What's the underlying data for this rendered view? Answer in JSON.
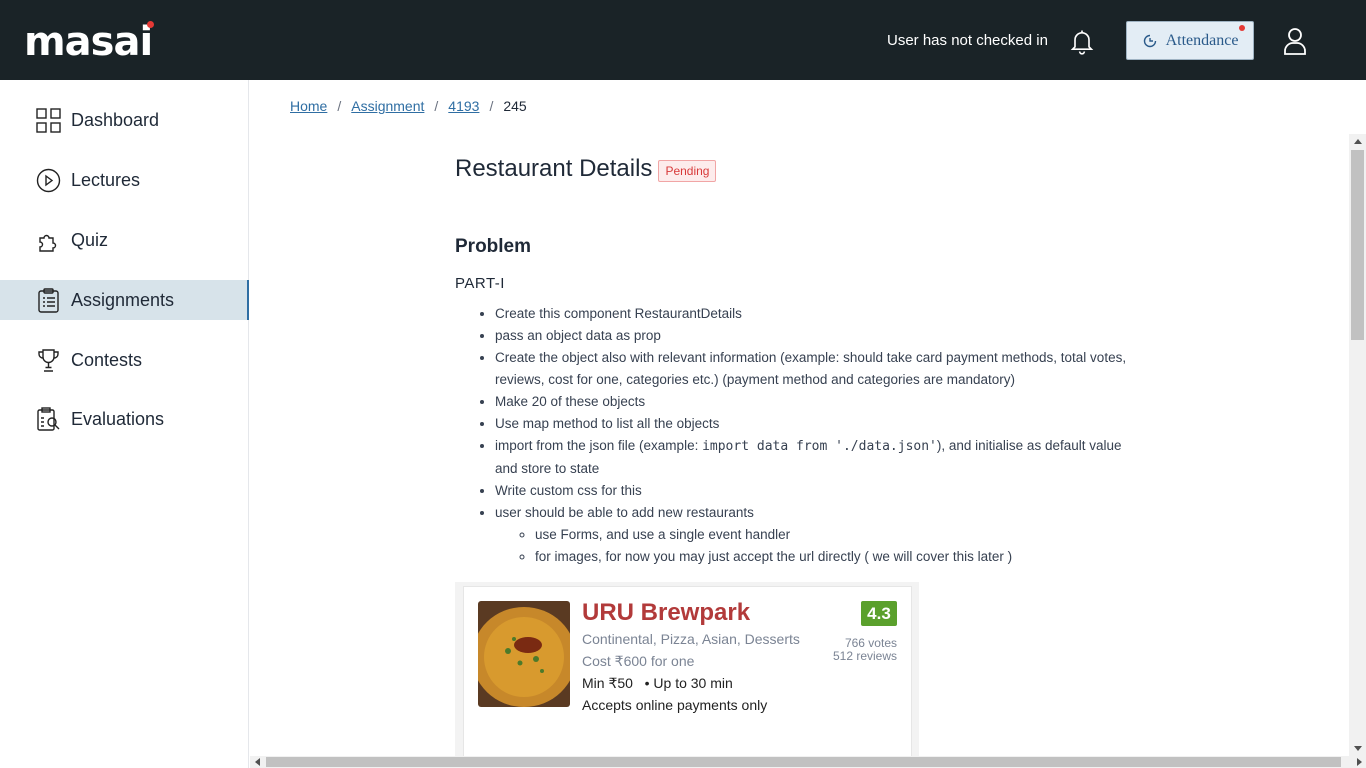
{
  "header": {
    "logo": "masai",
    "checkin_status": "User has not checked in",
    "attendance_label": "Attendance",
    "icons": [
      "bell-icon",
      "attendance-icon",
      "user-icon"
    ]
  },
  "sidebar": {
    "items": [
      {
        "label": "Dashboard",
        "icon": "dashboard-icon",
        "active": false
      },
      {
        "label": "Lectures",
        "icon": "play-circle-icon",
        "active": false
      },
      {
        "label": "Quiz",
        "icon": "puzzle-icon",
        "active": false
      },
      {
        "label": "Assignments",
        "icon": "clipboard-icon",
        "active": true
      },
      {
        "label": "Contests",
        "icon": "trophy-icon",
        "active": false
      },
      {
        "label": "Evaluations",
        "icon": "evaluation-icon",
        "active": false
      }
    ]
  },
  "breadcrumb": {
    "items": [
      "Home",
      "Assignment",
      "4193"
    ],
    "current": "245",
    "separator": "/"
  },
  "main": {
    "title": "Restaurant Details",
    "status_badge": "Pending",
    "section_heading": "Problem",
    "part_label": "PART-I",
    "bullets": [
      "Create this component RestaurantDetails",
      "pass an object data as prop",
      "Create the object also with relevant information (example: should take card payment methods, total votes, reviews, cost for one, categories etc.) (payment method and categories are mandatory)",
      "Make 20 of these objects",
      "Use map method to list all the objects",
      {
        "before": "import from the json file (example: ",
        "code": "import data from './data.json'",
        "after": "), and initialise as default value and store to state"
      },
      "Write custom css for this",
      "user should be able to add new restaurants"
    ],
    "sub_bullets": [
      "use Forms, and use a single event handler",
      "for images, for now you may just accept the url directly ( we will cover this later )"
    ]
  },
  "restaurant_card": {
    "name": "URU Brewpark",
    "categories": "Continental, Pizza, Asian, Desserts",
    "cost": "Cost ₹600 for one",
    "min_order": "Min ₹50",
    "delivery": "Up to 30 min",
    "payment": "Accepts online payments only",
    "rating": "4.3",
    "votes": "766 votes",
    "reviews": "512 reviews"
  },
  "colors": {
    "topbar": "#1a2327",
    "accent": "#2f6ea3",
    "pending": "#d83a3a",
    "rating_green": "#5aa02c",
    "restaurant_name": "#b23a3a"
  }
}
